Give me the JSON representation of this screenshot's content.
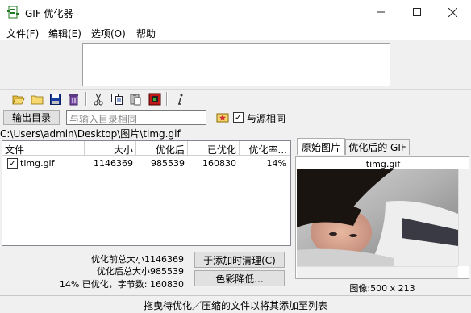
{
  "window": {
    "title": "GIF 优化器",
    "controls": {
      "minimize": "—",
      "maximize": "☐",
      "close": "✕"
    }
  },
  "menu": [
    "文件(F)",
    "编辑(E)",
    "选项(O)",
    "帮助"
  ],
  "toolbar_icons": [
    "open-folder-icon",
    "folder-icon",
    "save-icon",
    "recycle-icon",
    "cut-icon",
    "copy-icon",
    "paste-icon",
    "stop-icon",
    "info-icon"
  ],
  "output": {
    "button": "输出目录",
    "placeholder": "与输入目录相同",
    "same_as_source_checked": true,
    "same_as_source": "与源相同"
  },
  "path": "C:\\Users\\admin\\Desktop\\图片\\timg.gif",
  "file_list": {
    "columns": [
      "文件",
      "大小",
      "优化后",
      "已优化",
      "优化率..."
    ],
    "rows": [
      {
        "checked": true,
        "name": "timg.gif",
        "size": "1146369",
        "optimized": "985539",
        "saved": "160830",
        "ratio": "14%"
      }
    ]
  },
  "stats": {
    "before": "优化前总大小1146369",
    "after": "优化后总大小985539",
    "summary": "14% 已优化，字节数:  160830"
  },
  "buttons": {
    "clear_on_add": "于添加时清理(C)",
    "reduce_colors": "色彩降低..."
  },
  "preview": {
    "tabs": [
      "原始图片",
      "优化后的 GIF"
    ],
    "image_name": "timg.gif",
    "dims": "图像:500 x 213"
  },
  "status": "拖曳待优化／压缩的文件以将其添加至列表",
  "colors": {
    "window_bg": "#f0f0f0",
    "header_bg": "#ffffff",
    "accent": "#0060c0"
  }
}
